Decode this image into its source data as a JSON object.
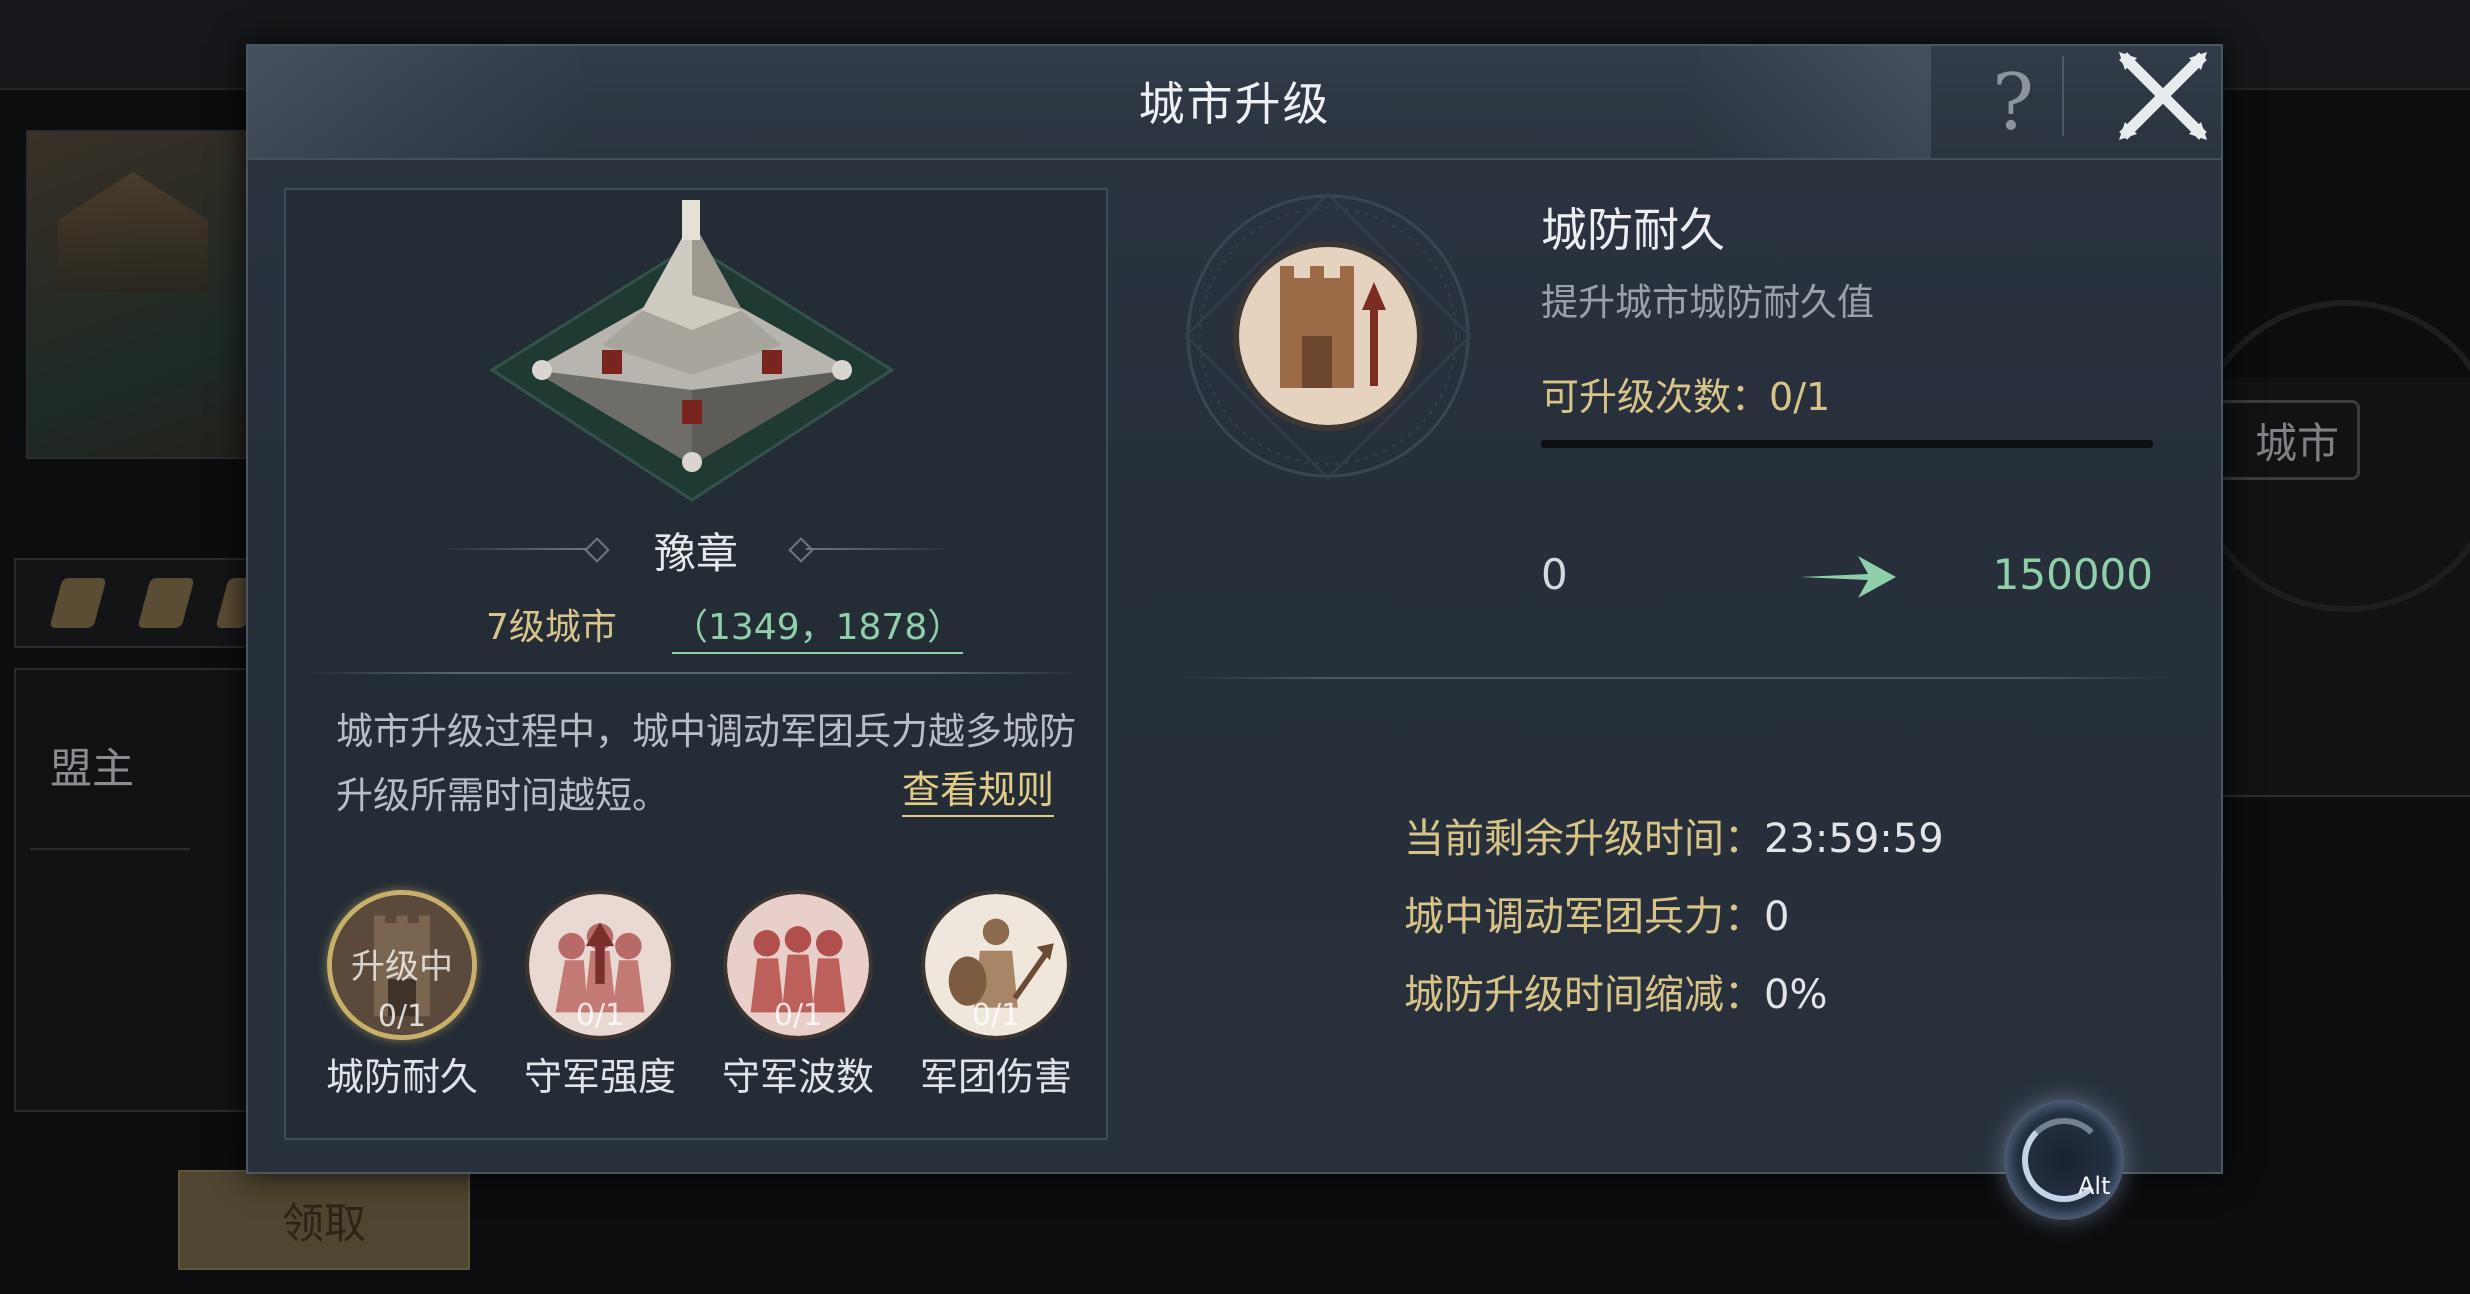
{
  "background": {
    "alliance_leader_label": "盟主",
    "claim_button": "领取",
    "city_tab_partial": "城市"
  },
  "dialog": {
    "title": "城市升级",
    "help_glyph": "?"
  },
  "city": {
    "name": "豫章",
    "level": "7级城市",
    "coords": "（1349，1878）",
    "description": "城市升级过程中，城中调动军团兵力越多城防升级所需时间越短。",
    "rules_link": "查看规则"
  },
  "techs": [
    {
      "label": "城防耐久",
      "status": "升级中",
      "count": "0/1",
      "selected": true,
      "icon": "fort-wall-icon"
    },
    {
      "label": "守军强度",
      "status": "",
      "count": "0/1",
      "selected": false,
      "icon": "garrison-strength-icon"
    },
    {
      "label": "守军波数",
      "status": "",
      "count": "0/1",
      "selected": false,
      "icon": "garrison-waves-icon"
    },
    {
      "label": "军团伤害",
      "status": "",
      "count": "0/1",
      "selected": false,
      "icon": "legion-damage-icon"
    }
  ],
  "detail": {
    "title": "城防耐久",
    "subtitle": "提升城市城防耐久值",
    "upgrade_count_label": "可升级次数：",
    "upgrade_count_value": "0/1",
    "upgrade_progress": 0,
    "value_from": "0",
    "value_to": "150000",
    "remaining_time_label": "当前剩余升级时间：",
    "remaining_time_value": "23:59:59",
    "troops_label": "城中调动军团兵力：",
    "troops_value": "0",
    "reduction_label": "城防升级时间缩减：",
    "reduction_value": "0%"
  },
  "floating": {
    "alt_label": "Alt"
  },
  "colors": {
    "accent_gold": "#d9c488",
    "value_green": "#8fd0ab",
    "panel_bg": "#28313b"
  }
}
